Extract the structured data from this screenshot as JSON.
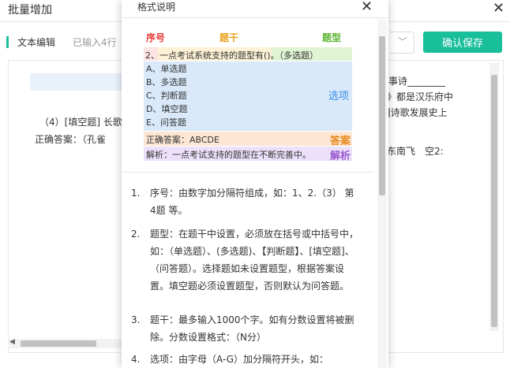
{
  "bg_dialog": {
    "title": "批量增加",
    "tab_label": "文本编辑",
    "char_count": "已输入4行",
    "confirm_label": "确认保存",
    "editor_line1": "（4）[填空题] 长歌",
    "editor_line2": "正确答案：（孔雀",
    "preview_lines": [
      "事诗________",
      "》都是汉乐府中",
      "]诗歌发展史上",
      "东南飞　空2:"
    ]
  },
  "modal": {
    "title": "格式说明",
    "diagram": {
      "hdr_seq": "序号",
      "hdr_stem": "题干",
      "hdr_type": "题型",
      "question_line": "2、一点考试系统支持的题型有()。（多选题）",
      "options": [
        "A、单选题",
        "B、多选题",
        "C、判断题",
        "D、填空题",
        "E、问答题"
      ],
      "options_tag": "选项",
      "answer_line": "正确答案：ABCDE",
      "answer_tag": "答案",
      "analysis_line": "解析：一点考试支持的题型在不断完善中。",
      "analysis_tag": "解析"
    },
    "list": [
      {
        "num": "1.",
        "text": "序号：由数字加分隔符组成，如：1、2.（3） 第4题 等。"
      },
      {
        "num": "2.",
        "text": "题型：在题干中设置，必须放在括号或中括号中，如：（单选题）、(多选题)、【判断题】、[填空题]、（问答题）。选择题如未设置题型，根据答案设置。填空题必须设置题型，否则默认为问答题。"
      },
      {
        "num": "3.",
        "text": "题干：最多输入1000个字。如有分数设置将被删除。分数设置格式：（N分）"
      },
      {
        "num": "4.",
        "text": "选项：由字母（A-G）加分隔符开头，如："
      }
    ]
  },
  "colors": {
    "accent": "#19be9b",
    "seq_red": "#e8433d",
    "stem_orange": "#e8a21c",
    "type_green": "#5bb531",
    "options_blue": "#3a8ee6",
    "answer_orange": "#e88a1c",
    "analysis_purple": "#9b59d0"
  }
}
